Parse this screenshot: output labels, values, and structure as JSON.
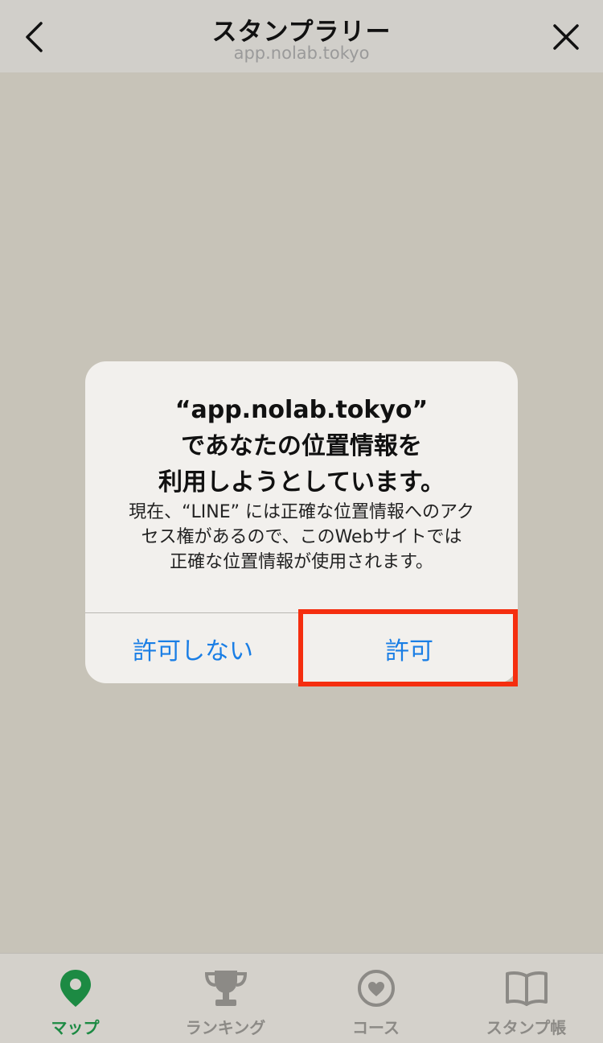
{
  "header": {
    "title": "スタンプラリー",
    "url": "app.nolab.tokyo"
  },
  "dialog": {
    "title_lines": [
      "“app.nolab.tokyo”",
      "であなたの位置情報を",
      "利用しようとしています。"
    ],
    "message_lines": [
      "現在、“LINE” には正確な位置情報へのアク",
      "セス権があるので、このWebサイトでは",
      "正確な位置情報が使用されます。"
    ],
    "deny_label": "許可しない",
    "allow_label": "許可"
  },
  "tabs": [
    {
      "label": "マップ",
      "icon": "map-pin-icon",
      "active": true
    },
    {
      "label": "ランキング",
      "icon": "trophy-icon",
      "active": false
    },
    {
      "label": "コース",
      "icon": "heart-circle-icon",
      "active": false
    },
    {
      "label": "スタンプ帳",
      "icon": "book-icon",
      "active": false
    }
  ],
  "colors": {
    "accent": "#1c8a43",
    "link": "#1a7ee5",
    "highlight": "#f52e0f",
    "background": "#c7c3b8"
  }
}
